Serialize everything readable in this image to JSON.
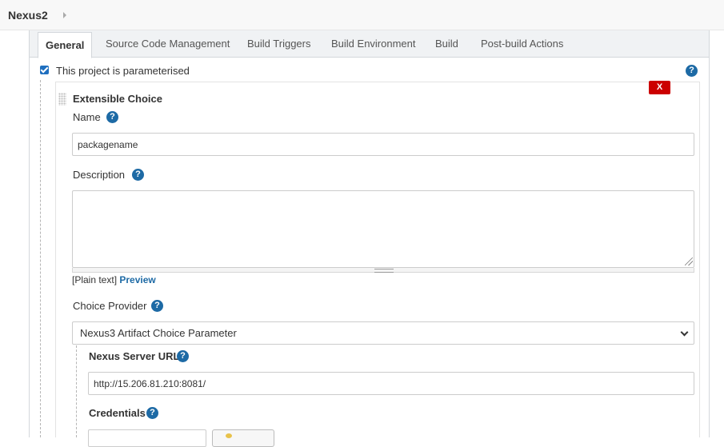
{
  "breadcrumb": {
    "project": "Nexus2"
  },
  "tabs": [
    {
      "label": "General",
      "active": true
    },
    {
      "label": "Source Code Management",
      "active": false
    },
    {
      "label": "Build Triggers",
      "active": false
    },
    {
      "label": "Build Environment",
      "active": false
    },
    {
      "label": "Build",
      "active": false
    },
    {
      "label": "Post-build Actions",
      "active": false
    }
  ],
  "parameterised": {
    "label": "This project is parameterised",
    "checked": true
  },
  "parameter": {
    "title": "Extensible Choice",
    "delete_label": "X",
    "name_label": "Name",
    "name_value": "packagename",
    "description_label": "Description",
    "description_value": "",
    "format_prefix": "[Plain text]",
    "preview_label": "Preview",
    "choice_provider_label": "Choice Provider",
    "choice_provider_value": "Nexus3 Artifact Choice Parameter",
    "nexus_url_label": "Nexus Server URL",
    "nexus_url_value": "http://15.206.81.210:8081/",
    "credentials_label": "Credentials"
  },
  "help_icon_glyph": "?",
  "colors": {
    "accent": "#1d6aa5",
    "delete": "#cc0000",
    "checkbox": "#1f6fbf"
  },
  "icons": [
    "help-icon",
    "drag-handle-icon",
    "chevron-down-icon",
    "key-icon"
  ]
}
